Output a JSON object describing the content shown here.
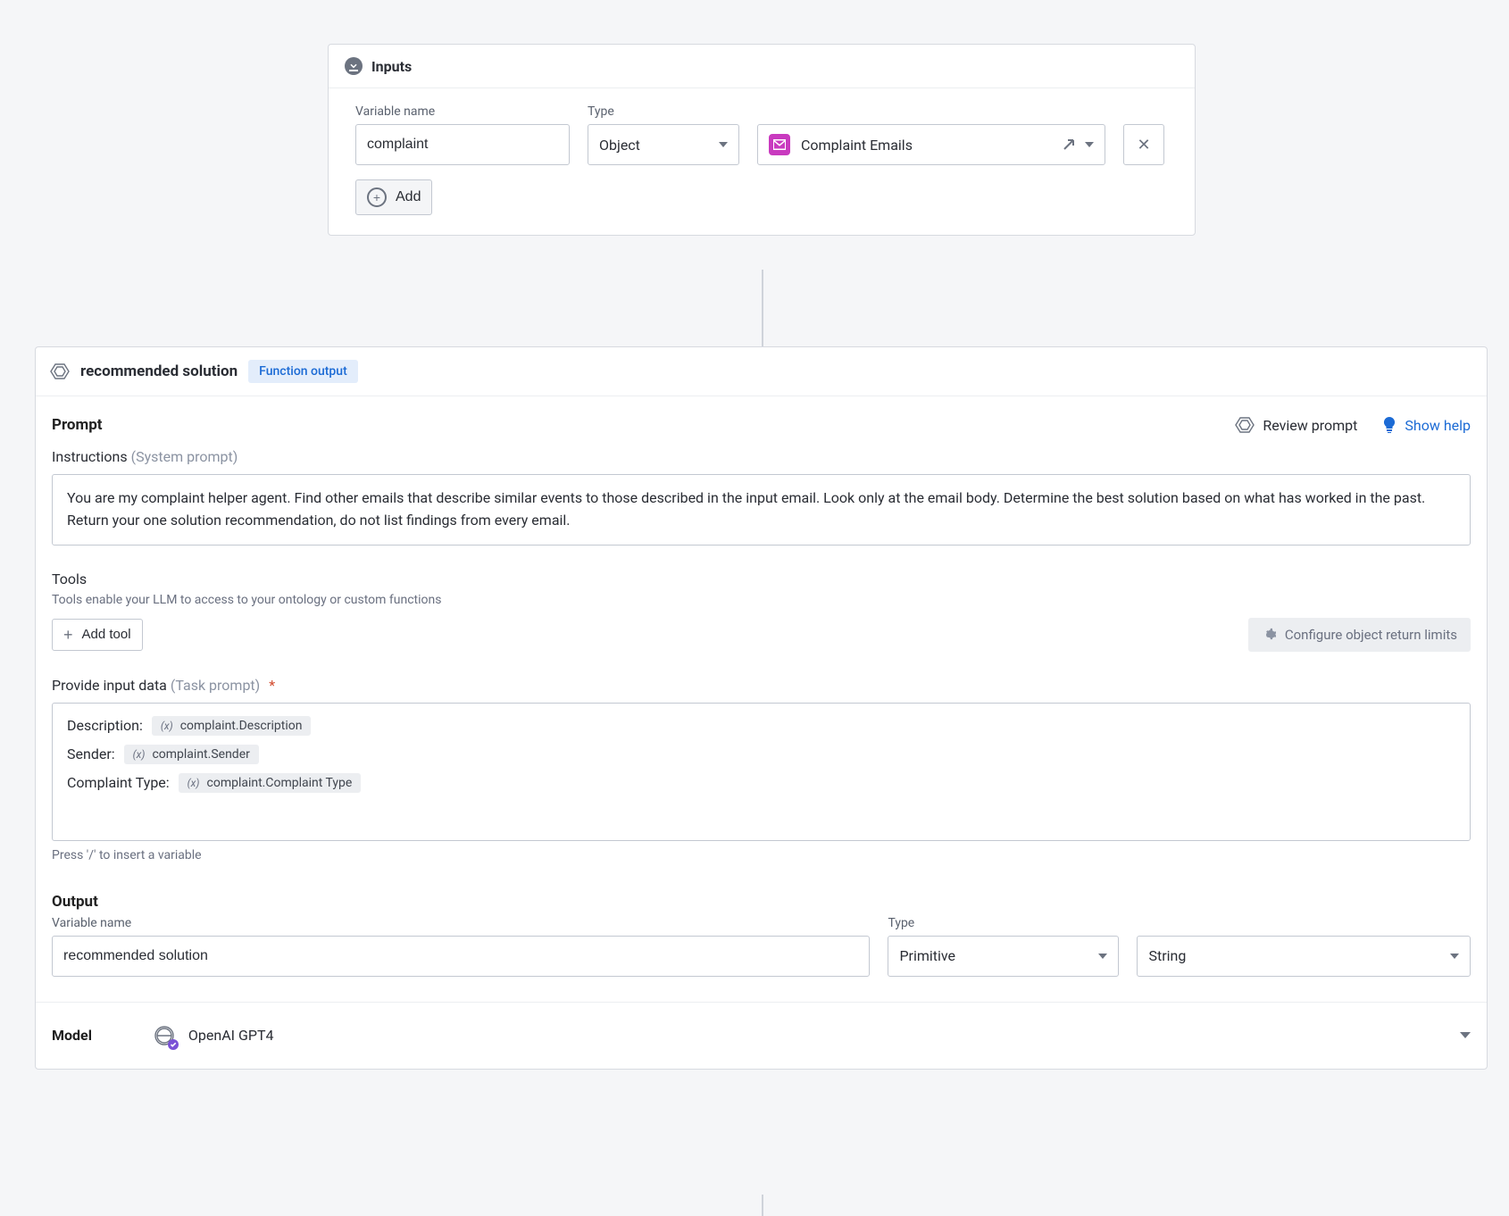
{
  "inputs": {
    "title": "Inputs",
    "variable_name_label": "Variable name",
    "type_label": "Type",
    "variable_name_value": "complaint",
    "type_value": "Object",
    "entity_label": "Complaint Emails",
    "add_label": "Add"
  },
  "main": {
    "title": "recommended solution",
    "badge": "Function output",
    "prompt_heading": "Prompt",
    "review_prompt": "Review prompt",
    "show_help": "Show help",
    "instructions_label": "Instructions",
    "instructions_hint": "(System prompt)",
    "instructions_value": "You are my complaint helper agent. Find other emails that describe similar events to those described in the input email. Look only at the email body. Determine the best solution based on what has worked in the past. Return your one solution recommendation, do not list findings from every email.",
    "tools_heading": "Tools",
    "tools_desc": "Tools enable your LLM to access to your ontology or custom functions",
    "add_tool": "Add tool",
    "configure_limits": "Configure object return limits",
    "provide_label": "Provide input data",
    "provide_hint": "(Task prompt)",
    "task_rows": [
      {
        "label": "Description:",
        "var": "complaint.Description"
      },
      {
        "label": "Sender:",
        "var": "complaint.Sender"
      },
      {
        "label": "Complaint Type:",
        "var": "complaint.Complaint Type"
      }
    ],
    "slash_hint": "Press '/' to insert a variable",
    "output_heading": "Output",
    "out_varname_label": "Variable name",
    "out_type_label": "Type",
    "out_varname_value": "recommended solution",
    "out_type_primitive": "Primitive",
    "out_type_string": "String",
    "model_heading": "Model",
    "model_name": "OpenAI GPT4"
  },
  "icons": {
    "fx": "(x)"
  }
}
